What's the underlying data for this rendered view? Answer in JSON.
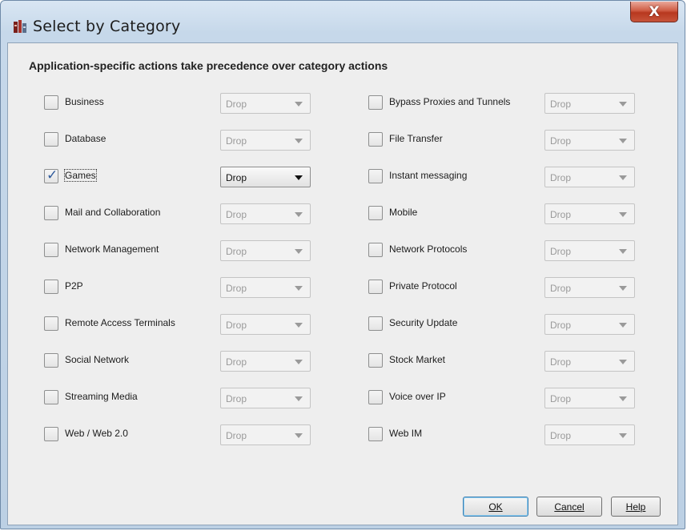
{
  "window": {
    "title": "Select by Category",
    "close_label": "X",
    "icon": "firewall-app-icon"
  },
  "heading": "Application-specific actions take precedence over category actions",
  "categories_left": [
    {
      "label": "Business",
      "checked": false,
      "action": "Drop"
    },
    {
      "label": "Database",
      "checked": false,
      "action": "Drop"
    },
    {
      "label": "Games",
      "checked": true,
      "action": "Drop"
    },
    {
      "label": "Mail and Collaboration",
      "checked": false,
      "action": "Drop"
    },
    {
      "label": "Network Management",
      "checked": false,
      "action": "Drop"
    },
    {
      "label": "P2P",
      "checked": false,
      "action": "Drop"
    },
    {
      "label": "Remote Access Terminals",
      "checked": false,
      "action": "Drop"
    },
    {
      "label": "Social Network",
      "checked": false,
      "action": "Drop"
    },
    {
      "label": "Streaming Media",
      "checked": false,
      "action": "Drop"
    },
    {
      "label": "Web / Web 2.0",
      "checked": false,
      "action": "Drop"
    }
  ],
  "categories_right": [
    {
      "label": "Bypass Proxies and Tunnels",
      "checked": false,
      "action": "Drop"
    },
    {
      "label": "File Transfer",
      "checked": false,
      "action": "Drop"
    },
    {
      "label": "Instant messaging",
      "checked": false,
      "action": "Drop"
    },
    {
      "label": "Mobile",
      "checked": false,
      "action": "Drop"
    },
    {
      "label": "Network Protocols",
      "checked": false,
      "action": "Drop"
    },
    {
      "label": "Private Protocol",
      "checked": false,
      "action": "Drop"
    },
    {
      "label": "Security Update",
      "checked": false,
      "action": "Drop"
    },
    {
      "label": "Stock Market",
      "checked": false,
      "action": "Drop"
    },
    {
      "label": "Voice over IP",
      "checked": false,
      "action": "Drop"
    },
    {
      "label": "Web IM",
      "checked": false,
      "action": "Drop"
    }
  ],
  "buttons": {
    "ok": "OK",
    "cancel": "Cancel",
    "help": "Help"
  }
}
